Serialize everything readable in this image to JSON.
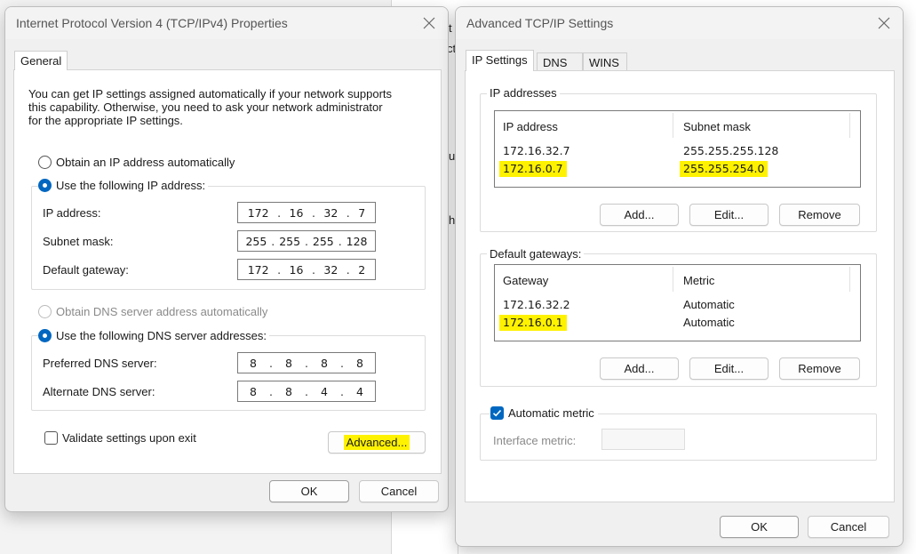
{
  "background": {
    "fragments": [
      "t",
      "ct",
      "u",
      "h"
    ]
  },
  "ipv4": {
    "title": "Internet Protocol Version 4 (TCP/IPv4) Properties",
    "tab_general": "General",
    "intro": [
      "You can get IP settings assigned automatically if your network supports",
      "this capability. Otherwise, you need to ask your network administrator",
      "for the appropriate IP settings."
    ],
    "obtain_ip_auto": "Obtain an IP address automatically",
    "use_following_ip": "Use the following IP address:",
    "ip_label": "IP address:",
    "ip_value": [
      "172",
      "16",
      "32",
      "7"
    ],
    "subnet_label": "Subnet mask:",
    "subnet_value": [
      "255",
      "255",
      "255",
      "128"
    ],
    "gateway_label": "Default gateway:",
    "gateway_value": [
      "172",
      "16",
      "32",
      "2"
    ],
    "obtain_dns_auto": "Obtain DNS server address automatically",
    "use_following_dns": "Use the following DNS server addresses:",
    "pref_dns_label": "Preferred DNS server:",
    "pref_dns_value": [
      "8",
      "8",
      "8",
      "8"
    ],
    "alt_dns_label": "Alternate DNS server:",
    "alt_dns_value": [
      "8",
      "8",
      "4",
      "4"
    ],
    "validate_label": "Validate settings upon exit",
    "advanced_button": "Advanced...",
    "ok_button": "OK",
    "cancel_button": "Cancel"
  },
  "advanced": {
    "title": "Advanced TCP/IP Settings",
    "tabs": [
      "IP Settings",
      "DNS",
      "WINS"
    ],
    "ip_addresses_group": "IP addresses",
    "ip_columns": [
      "IP address",
      "Subnet mask"
    ],
    "ip_rows": [
      {
        "ip": "172.16.32.7",
        "mask": "255.255.255.128"
      },
      {
        "ip": "172.16.0.7",
        "mask": "255.255.254.0"
      }
    ],
    "gateways_group": "Default gateways:",
    "gateway_columns": [
      "Gateway",
      "Metric"
    ],
    "gateway_rows": [
      {
        "gateway": "172.16.32.2",
        "metric": "Automatic"
      },
      {
        "gateway": "172.16.0.1",
        "metric": "Automatic"
      }
    ],
    "add_button": "Add...",
    "edit_button": "Edit...",
    "remove_button": "Remove",
    "automatic_metric": "Automatic metric",
    "interface_metric_label": "Interface metric:",
    "ok_button": "OK",
    "cancel_button": "Cancel"
  },
  "colors": {
    "highlight": "#fff200",
    "accent": "#0067c0"
  }
}
